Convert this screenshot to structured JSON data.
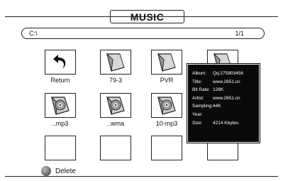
{
  "header": {
    "title": "MUSIC"
  },
  "path_bar": {
    "path": "C:\\",
    "page": "1/1"
  },
  "grid": {
    "items": [
      {
        "label": "Return",
        "icon": "return-arrow-icon"
      },
      {
        "label": "79-3",
        "icon": "folder-icon"
      },
      {
        "label": "PVR",
        "icon": "folder-icon"
      },
      {
        "label": "",
        "icon": "folder-icon"
      },
      {
        "label": "..mp3",
        "icon": "music-disc-icon"
      },
      {
        "label": "..wma",
        "icon": "music-disc-icon"
      },
      {
        "label": "10-mp3",
        "icon": "music-disc-icon"
      },
      {
        "label": "",
        "icon": ""
      },
      {
        "label": "",
        "icon": ""
      },
      {
        "label": "",
        "icon": ""
      },
      {
        "label": "",
        "icon": ""
      },
      {
        "label": "",
        "icon": ""
      }
    ]
  },
  "info": {
    "rows": [
      {
        "key": "Album:",
        "value": "Qq:275803456"
      },
      {
        "key": "Title:",
        "value": "www.2651.cn"
      },
      {
        "key": "Bit Rate:",
        "value": "128K"
      },
      {
        "key": "Artist:",
        "value": "www.2651.cn"
      },
      {
        "key": "Sampling:",
        "value": "44K"
      },
      {
        "key": "Year:",
        "value": ""
      },
      {
        "key": "Size:",
        "value": "4214 Kbytes"
      }
    ]
  },
  "footer": {
    "delete_label": "Delete",
    "delete_color": "#666666"
  }
}
